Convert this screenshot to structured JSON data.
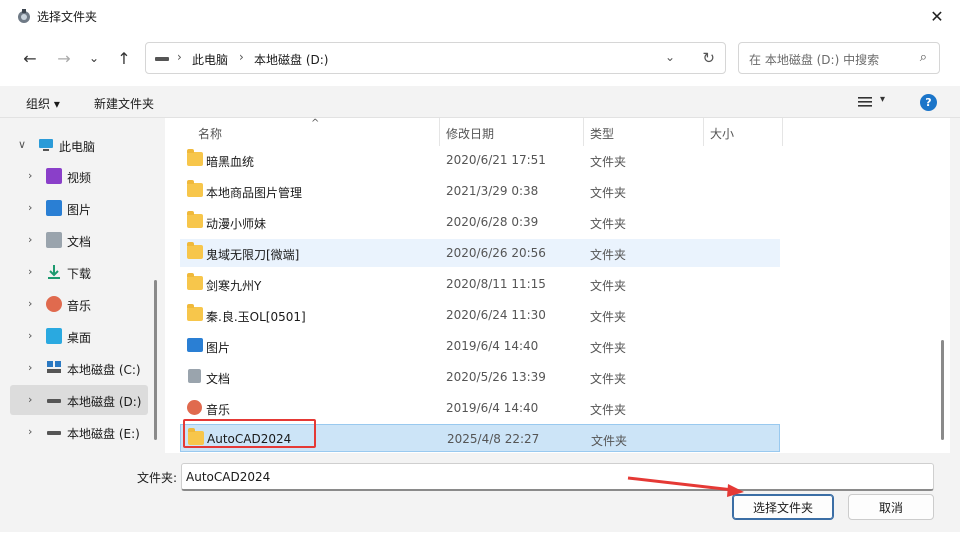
{
  "title": "选择文件夹",
  "close_glyph": "✕",
  "nav": {
    "back": "←",
    "forward": "→",
    "recent": "⌄",
    "up": "↑"
  },
  "address": {
    "crumbs": [
      "此电脑",
      "本地磁盘 (D:)"
    ],
    "sep": "›",
    "dropdown": "⌄",
    "refresh": "↻"
  },
  "search": {
    "placeholder": "在 本地磁盘 (D:) 中搜索",
    "icon": "⌕"
  },
  "toolbar": {
    "organize": "组织 ▾",
    "new_folder": "新建文件夹",
    "view_caret": "▾",
    "help": "?"
  },
  "tree": [
    {
      "label": "此电脑",
      "chevron": "∨",
      "icon": "monitor-icon",
      "color": "#2b9bd8"
    },
    {
      "label": "视频",
      "chevron": "›",
      "icon": "video-icon",
      "color": "#8a3fc9"
    },
    {
      "label": "图片",
      "chevron": "›",
      "icon": "picture-icon",
      "color": "#2a7fd4"
    },
    {
      "label": "文档",
      "chevron": "›",
      "icon": "document-icon",
      "color": "#9aa4ad"
    },
    {
      "label": "下载",
      "chevron": "›",
      "icon": "download-icon",
      "color": "#1c9a6e"
    },
    {
      "label": "音乐",
      "chevron": "›",
      "icon": "music-icon",
      "color": "#e06a4e"
    },
    {
      "label": "桌面",
      "chevron": "›",
      "icon": "desktop-icon",
      "color": "#2aa9e0"
    },
    {
      "label": "本地磁盘 (C:)",
      "chevron": "›",
      "icon": "windows-drive-icon",
      "color": "#2b79c2"
    },
    {
      "label": "本地磁盘 (D:)",
      "chevron": "›",
      "icon": "drive-icon",
      "color": "#555555"
    },
    {
      "label": "本地磁盘 (E:)",
      "chevron": "›",
      "icon": "drive-icon",
      "color": "#555555"
    }
  ],
  "columns": {
    "name": "名称",
    "date": "修改日期",
    "type": "类型",
    "size": "大小",
    "sort_glyph": "^"
  },
  "rows": [
    {
      "name": "暗黑血统",
      "date": "2020/6/21 17:51",
      "type": "文件夹",
      "icon": "folder-icon"
    },
    {
      "name": "本地商品图片管理",
      "date": "2021/3/29 0:38",
      "type": "文件夹",
      "icon": "folder-icon"
    },
    {
      "name": "动漫小师妹",
      "date": "2020/6/28 0:39",
      "type": "文件夹",
      "icon": "folder-icon"
    },
    {
      "name": "鬼域无限刀[微端]",
      "date": "2020/6/26 20:56",
      "type": "文件夹",
      "icon": "folder-icon"
    },
    {
      "name": "剑寒九州Y",
      "date": "2020/8/11 11:15",
      "type": "文件夹",
      "icon": "folder-icon"
    },
    {
      "name": "秦.良.玉OL[0501]",
      "date": "2020/6/24 11:30",
      "type": "文件夹",
      "icon": "folder-icon"
    },
    {
      "name": "图片",
      "date": "2019/6/4 14:40",
      "type": "文件夹",
      "icon": "picture-icon"
    },
    {
      "name": "文档",
      "date": "2020/5/26 13:39",
      "type": "文件夹",
      "icon": "document-icon"
    },
    {
      "name": "音乐",
      "date": "2019/6/4 14:40",
      "type": "文件夹",
      "icon": "music-icon"
    },
    {
      "name": "AutoCAD2024",
      "date": "2025/4/8 22:27",
      "type": "文件夹",
      "icon": "folder-icon"
    }
  ],
  "folder_field": {
    "label": "文件夹:",
    "value": "AutoCAD2024"
  },
  "buttons": {
    "select": "选择文件夹",
    "cancel": "取消"
  },
  "colors": {
    "accent": "#1b75c9",
    "annotation": "#e53935",
    "selection": "#cce4f7"
  }
}
